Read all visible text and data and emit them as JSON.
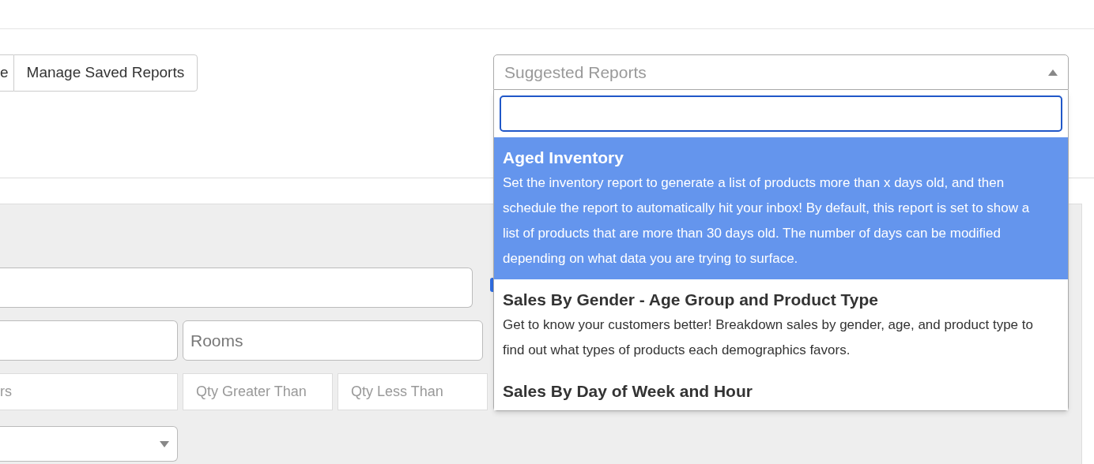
{
  "toolbar": {
    "buttons": [
      "e",
      "Manage Saved Reports"
    ]
  },
  "filters": {
    "row_2": [
      {
        "placeholder": "Rooms"
      }
    ],
    "row_3": [
      {
        "placeholder": "rs"
      },
      {
        "placeholder": "Qty Greater Than"
      },
      {
        "placeholder": "Qty Less Than"
      }
    ]
  },
  "suggested_reports": {
    "placeholder": "Suggested Reports",
    "expanded": true,
    "options": [
      {
        "title": "Aged Inventory",
        "description": "Set the inventory report to generate a list of products more than x days old, and then schedule the report to automatically hit your inbox! By default, this report is set to show a list of products that are more than 30 days old. The number of days can be modified depending on what data you are trying to surface.",
        "selected": true
      },
      {
        "title": "Sales By Gender - Age Group and Product Type",
        "description": "Get to know your customers better! Breakdown sales by gender, age, and product type to find out what types of products each demographics favors.",
        "selected": false
      },
      {
        "title": "Sales By Day of Week and Hour",
        "selected": false
      }
    ]
  }
}
